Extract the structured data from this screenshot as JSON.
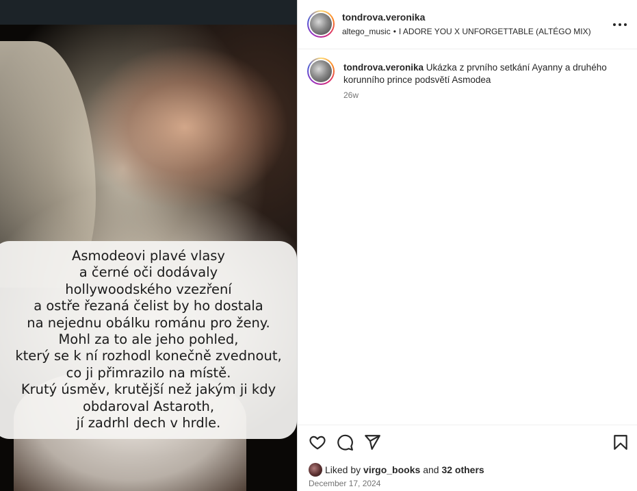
{
  "media": {
    "caption_lines": "Asmodeovi plavé vlasy\na černé oči dodávaly\nhollywoodského vzezření\na ostře řezaná čelist by ho dostala\nna nejednu obálku románu pro ženy.\nMohl za to ale jeho pohled,\nkterý se k ní rozhodl konečně zvednout,\nco ji přimrazilo na místě.\nKrutý úsměv, krutější než jakým ji kdy\nobdaroval Astaroth,\njí zadrhl dech v hrdle."
  },
  "header": {
    "username": "tondrova.veronika",
    "audio_artist": "altego_music",
    "audio_separator": "•",
    "audio_title": "I ADORE YOU X UNFORGETTABLE (ALTÉGO MIX)",
    "more_icon": "more-horizontal-icon"
  },
  "comment": {
    "username": "tondrova.veronika",
    "text": "Ukázka z prvního setkání Ayanny a druhého korunního prince podsvětí Asmodea",
    "time": "26w"
  },
  "actions": {
    "icons": [
      "heart-icon",
      "comment-icon",
      "share-icon",
      "bookmark-icon"
    ]
  },
  "likes": {
    "prefix": "Liked by",
    "user": "virgo_books",
    "middle": "and",
    "others": "32 others"
  },
  "post_date": "December 17, 2024",
  "colors": {
    "text": "#262626",
    "secondary": "#737373",
    "border": "#dbdbdb"
  }
}
